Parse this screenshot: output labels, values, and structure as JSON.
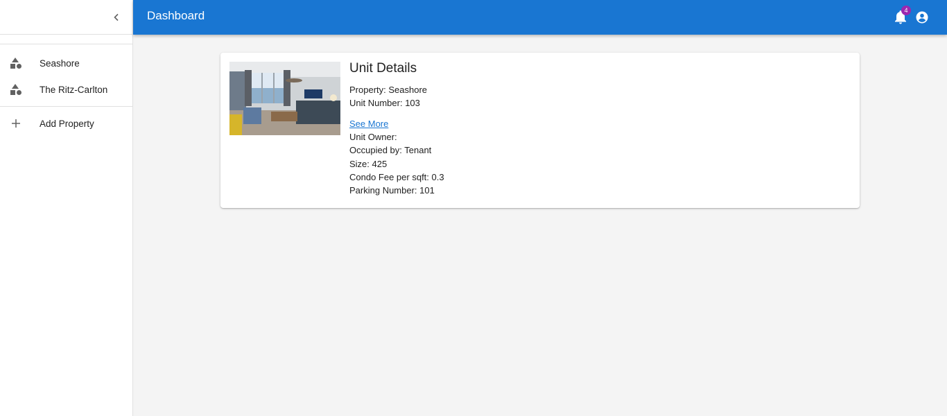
{
  "sidebar": {
    "items": [
      {
        "label": "Seashore",
        "icon": "shapes-icon"
      },
      {
        "label": "The Ritz-Carlton",
        "icon": "shapes-icon"
      }
    ],
    "add_label": "Add Property"
  },
  "header": {
    "title": "Dashboard",
    "notification_count": "4"
  },
  "unit": {
    "title": "Unit Details",
    "property": "Property: Seashore",
    "unit_number": "Unit Number: 103",
    "see_more": "See More",
    "owner": "Unit Owner:",
    "occupied_by": "Occupied by: Tenant",
    "size": "Size: 425",
    "condo_fee": "Condo Fee per sqft: 0.3",
    "parking": "Parking Number: 101"
  },
  "colors": {
    "appbar": "#1976d2",
    "badge": "#9c27b0",
    "link": "#1976d2"
  }
}
